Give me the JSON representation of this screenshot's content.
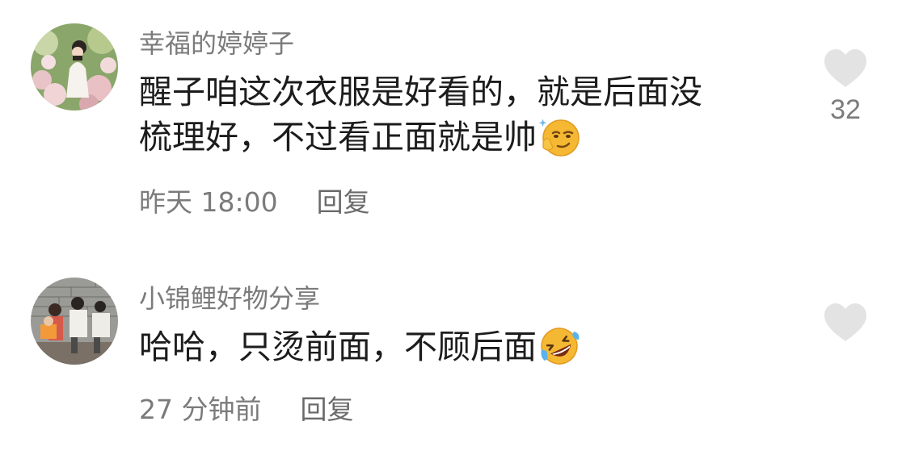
{
  "comments": [
    {
      "username": "幸福的婷婷子",
      "lines": [
        "醒子咱这次衣服是好看的，就是后面没",
        "梳理好，不过看正面就是帅"
      ],
      "emoji": "smirk-emoji",
      "time": "昨天 18:00",
      "reply_label": "回复",
      "like_icon": "heart-icon",
      "like_count": "32"
    },
    {
      "username": "小锦鲤好物分享",
      "lines": [
        "哈哈，只烫前面，不顾后面"
      ],
      "emoji": "rolling-laughing-emoji",
      "time": "27 分钟前",
      "reply_label": "回复",
      "like_icon": "heart-icon",
      "like_count": ""
    }
  ],
  "colors": {
    "username": "#7b7b7b",
    "text": "#1c1c1c",
    "heart": "#e3e3e3",
    "emoji_face": "#f5b833"
  }
}
